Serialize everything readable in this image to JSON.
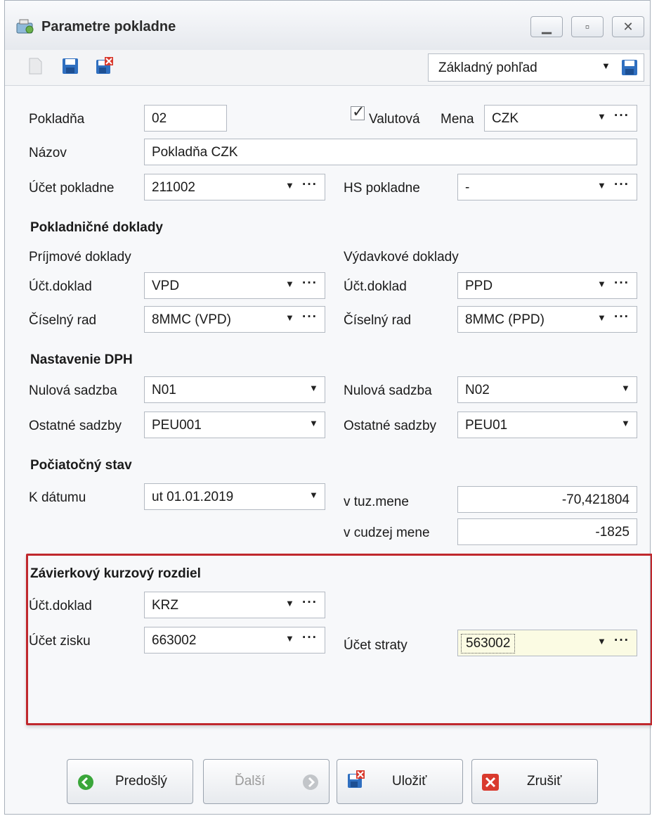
{
  "window": {
    "title": "Parametre pokladne"
  },
  "toolbar": {
    "view_selected": "Základný pohľad"
  },
  "colors": {
    "accent_red": "#c0282d",
    "highlight_field": "#fbfbe3",
    "nav_green": "#3aa63a"
  },
  "general": {
    "pokladna_label": "Pokladňa",
    "pokladna_value": "02",
    "valutova_label": "Valutová",
    "valutova_checked": true,
    "mena_label": "Mena",
    "mena_value": "CZK",
    "nazov_label": "Názov",
    "nazov_value": "Pokladňa CZK",
    "ucet_label": "Účet pokladne",
    "ucet_value": "211002",
    "hs_label": "HS pokladne",
    "hs_value": "-"
  },
  "doklady": {
    "header": "Pokladničné doklady",
    "prijmove": "Príjmové doklady",
    "vydavkove": "Výdavkové doklady",
    "uctdoklad_label": "Účt.doklad",
    "ciselny_label": "Číselný rad",
    "prij_uctdoklad": "VPD",
    "prij_ciselny": "8MMC (VPD)",
    "vyd_uctdoklad": "PPD",
    "vyd_ciselny": "8MMC (PPD)"
  },
  "dph": {
    "header": "Nastavenie DPH",
    "nulova_label": "Nulová sadzba",
    "ostatne_label": "Ostatné sadzby",
    "left_nulova": "N01",
    "left_ostatne": "PEU001",
    "right_nulova": "N02",
    "right_ostatne": "PEU01"
  },
  "pociatocny": {
    "header": "Počiatočný stav",
    "kdatumu_label": "K dátumu",
    "kdatumu_value": "ut 01.01.2019",
    "tuz_label": "v tuz.mene",
    "tuz_value": "-70,421804",
    "cudzej_label": "v cudzej mene",
    "cudzej_value": "-1825"
  },
  "zavierkovy": {
    "header": "Závierkový kurzový rozdiel",
    "uctdoklad_label": "Účt.doklad",
    "uctdoklad_value": "KRZ",
    "zisku_label": "Účet zisku",
    "zisku_value": "663002",
    "straty_label": "Účet straty",
    "straty_value": "563002"
  },
  "buttons": {
    "prev": "Predošlý",
    "next": "Ďalší",
    "save": "Uložiť",
    "cancel": "Zrušiť"
  },
  "glyphs": {
    "dropdown": "▼",
    "ellipsis": "···",
    "check": "✓"
  }
}
